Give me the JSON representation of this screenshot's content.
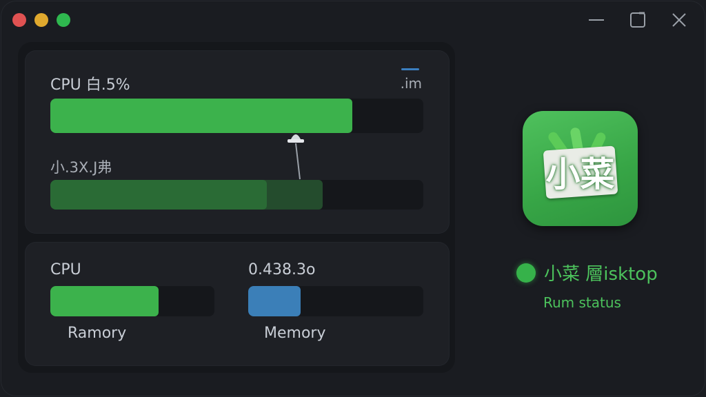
{
  "window": {
    "controls": {
      "close": "close",
      "minimize": "minimize",
      "zoom": "zoom"
    }
  },
  "top_panel": {
    "cpu_label": "CPU 白.5%",
    "unit_label": ".im",
    "cpu_bar": {
      "value": 0.81,
      "color": "#3cb24c"
    },
    "second_label": "小.3X.J弗",
    "second_bar": {
      "value": 0.58,
      "secondary_value": 0.73,
      "color": "#2a6b35",
      "secondary_color": "#244c2d"
    }
  },
  "bottom_panel": {
    "cpu_label": "CPU",
    "cpu_bar": {
      "value": 0.66,
      "color": "#3cb24c"
    },
    "cpu_caption": "Ramory",
    "mem_label": "0.438.3o",
    "mem_bar": {
      "value": 0.3,
      "color": "#3b7fb8"
    },
    "mem_caption": "Memory"
  },
  "app": {
    "icon_text": "小菜",
    "icon_name": "xiaocai-app-icon",
    "name": "小菜 層isktop",
    "status": "Rum status",
    "status_color": "#36b24a"
  }
}
